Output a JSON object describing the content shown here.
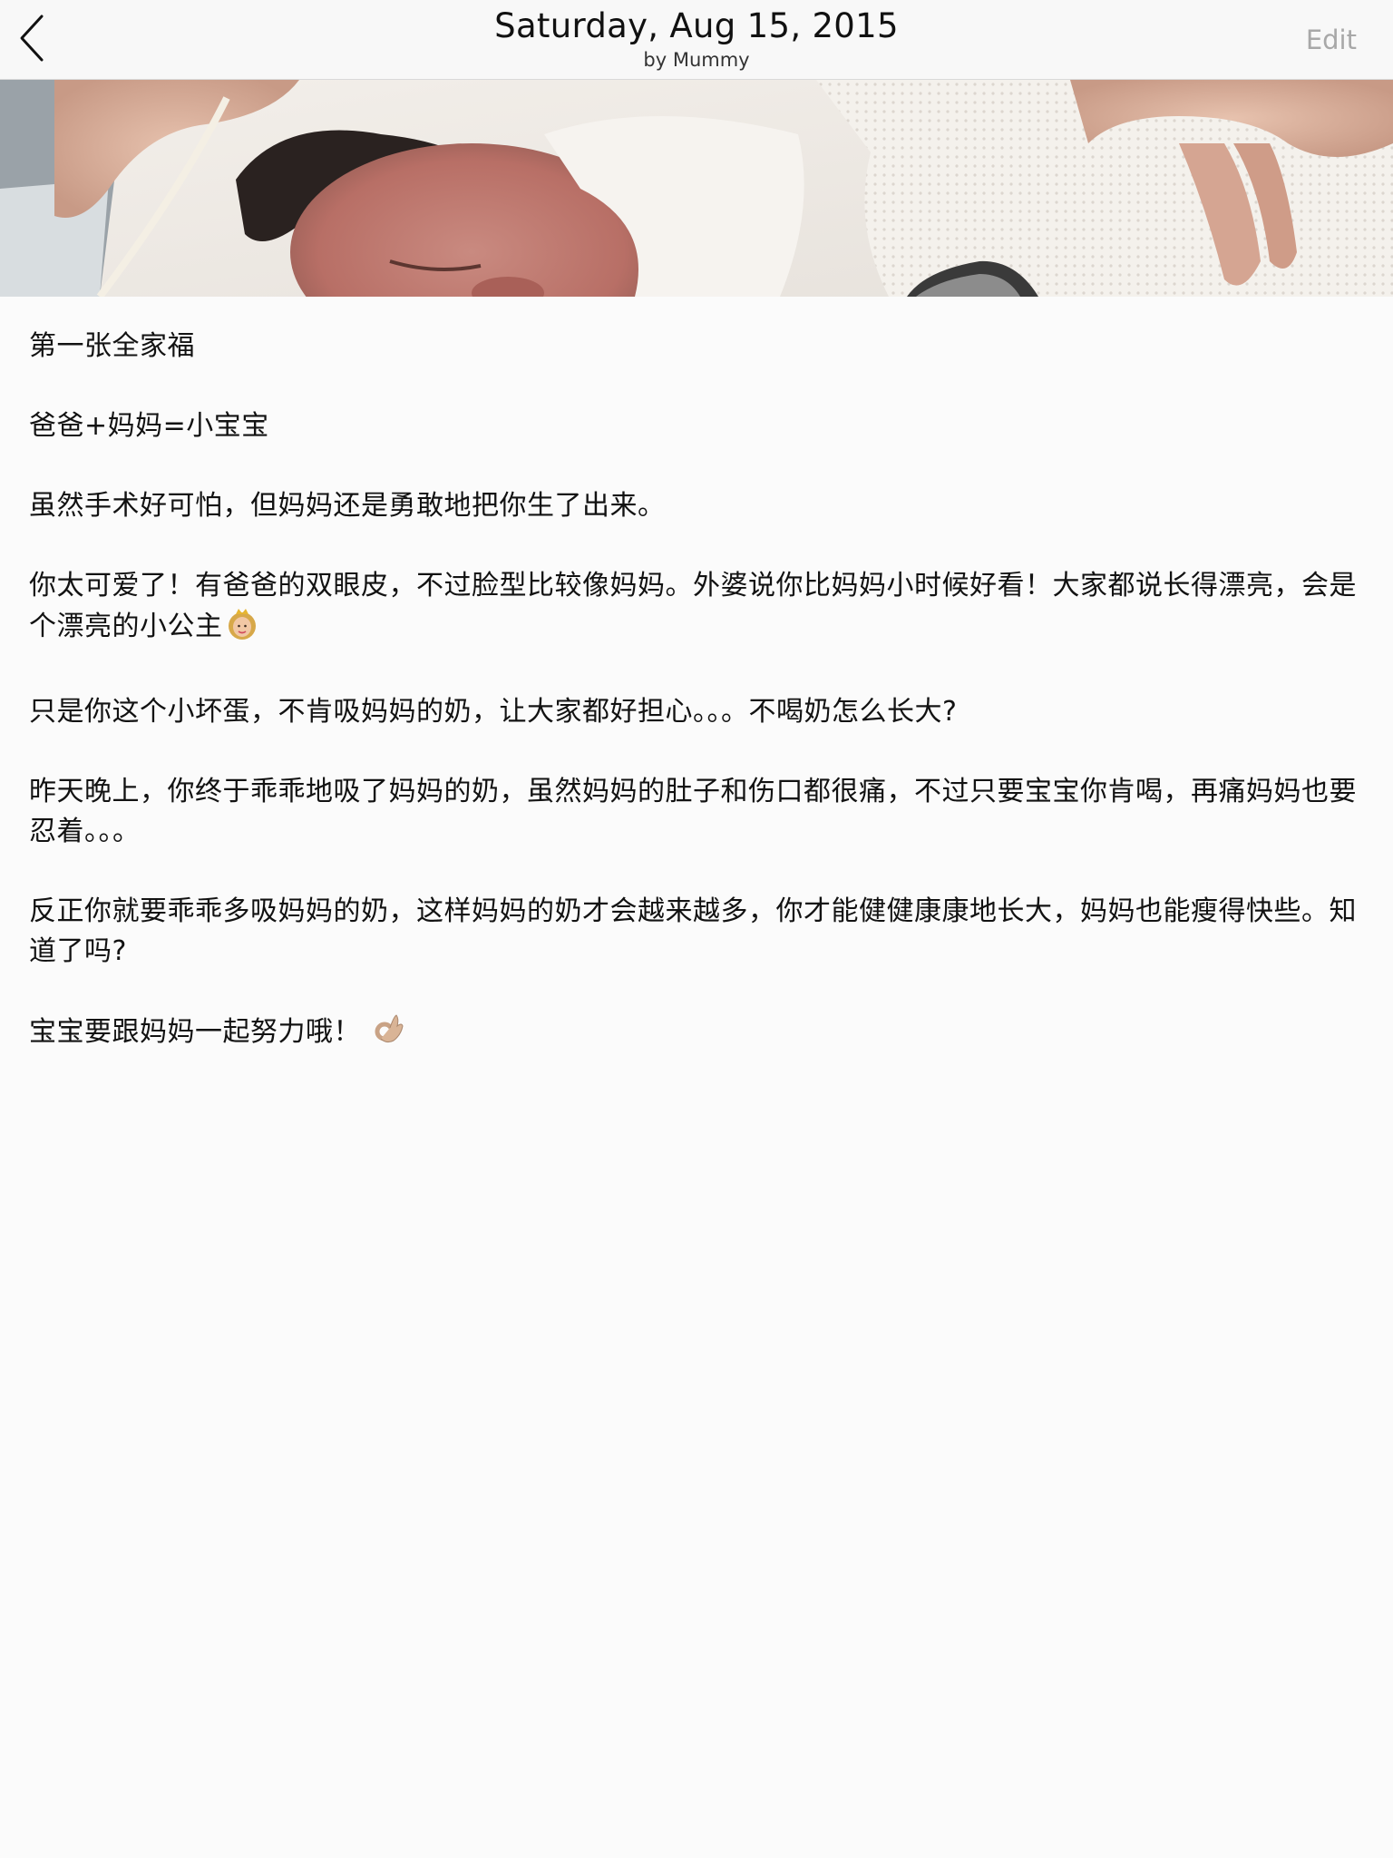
{
  "header": {
    "title": "Saturday, Aug 15, 2015",
    "subtitle": "by Mummy",
    "edit_label": "Edit",
    "back_icon": "chevron-left-icon"
  },
  "hero": {
    "description_icon": "newborn-photo"
  },
  "entry": {
    "paragraphs": [
      "第一张全家福",
      "爸爸+妈妈=小宝宝",
      "虽然手术好可怕，但妈妈还是勇敢地把你生了出来。",
      "你太可爱了！有爸爸的双眼皮，不过脸型比较像妈妈。外婆说你比妈妈小时候好看！大家都说长得漂亮，会是个漂亮的小公主",
      "只是你这个小坏蛋，不肯吸妈妈的奶，让大家都好担心。。。不喝奶怎么长大?",
      "昨天晚上，你终于乖乖地吸了妈妈的奶，虽然妈妈的肚子和伤口都很痛，不过只要宝宝你肯喝，再痛妈妈也要忍着。。。",
      "反正你就要乖乖多吸妈妈的奶，这样妈妈的奶才会越来越多，你才能健健康康地长大，妈妈也能瘦得快些。知道了吗?",
      "宝宝要跟妈妈一起努力哦！"
    ],
    "emojis": {
      "princess": "princess-emoji",
      "ok_hand": "ok-hand-emoji"
    }
  },
  "colors": {
    "background": "#fbfbfb",
    "header_bg": "#f8f8f8",
    "edit_gray": "#a8a8a8",
    "text": "#121212"
  }
}
